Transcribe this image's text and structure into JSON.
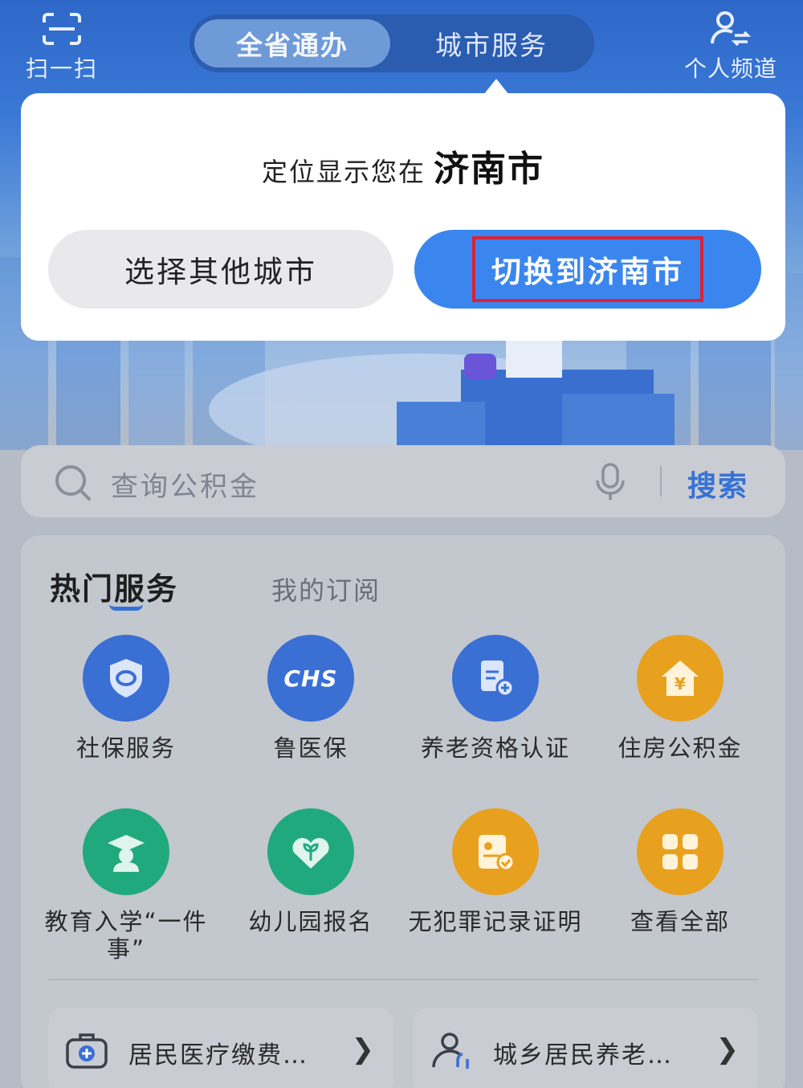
{
  "topbar": {
    "scan_label": "扫一扫",
    "tabs": [
      {
        "label": "全省通办",
        "active": true
      },
      {
        "label": "城市服务",
        "active": false
      }
    ],
    "profile_label": "个人频道"
  },
  "popup": {
    "message_prefix": "定位显示您在",
    "city": "济南市",
    "other_button": "选择其他城市",
    "switch_button": "切换到济南市"
  },
  "search": {
    "placeholder": "查询公积金",
    "button": "搜索"
  },
  "services": {
    "tab_hot": "热门服务",
    "tab_subscription": "我的订阅",
    "items": [
      {
        "label": "社保服务",
        "icon": "social-security-icon",
        "color": "#3a6fd4"
      },
      {
        "label": "鲁医保",
        "icon": "chs-medical-insurance-icon",
        "color": "#3a6fd4"
      },
      {
        "label": "养老资格认证",
        "icon": "pension-certification-icon",
        "color": "#3a6fd4"
      },
      {
        "label": "住房公积金",
        "icon": "housing-fund-icon",
        "color": "#e8a11e"
      },
      {
        "label": "教育入学“一件事”",
        "icon": "graduate-cap-icon",
        "color": "#21a97e"
      },
      {
        "label": "幼儿园报名",
        "icon": "sprout-icon",
        "color": "#21a97e"
      },
      {
        "label": "无犯罪记录证明",
        "icon": "certificate-check-icon",
        "color": "#e8a11e"
      },
      {
        "label": "查看全部",
        "icon": "grid-apps-icon",
        "color": "#e8a11e"
      }
    ],
    "chs_text": "CHS"
  },
  "quick_links": [
    {
      "label": "居民医疗缴费…",
      "icon": "medical-kit-icon"
    },
    {
      "label": "城乡居民养老…",
      "icon": "elderly-person-icon"
    }
  ]
}
